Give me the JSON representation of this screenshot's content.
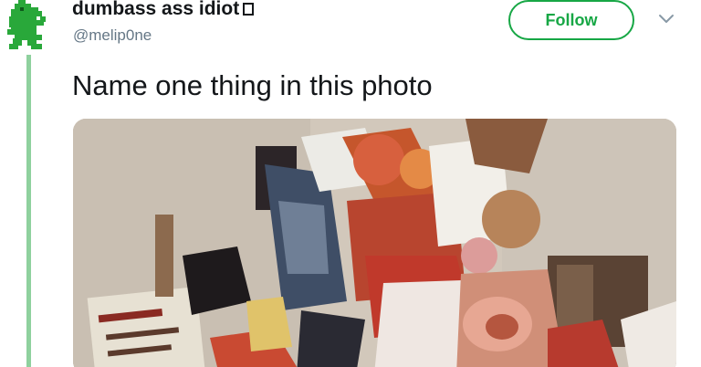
{
  "tweet": {
    "display_name": "dumbass ass idiot",
    "handle": "@melip0ne",
    "follow_label": "Follow",
    "text": "Name one thing in this photo"
  },
  "icons": {
    "avatar": "green-dragon-avatar-icon",
    "menu": "chevron-down-icon",
    "name_symbol": "missing-glyph-box-icon"
  },
  "colors": {
    "follow_accent": "#17a745",
    "thread_line": "#8fd19e",
    "text_primary": "#14171a",
    "text_secondary": "#657786"
  }
}
